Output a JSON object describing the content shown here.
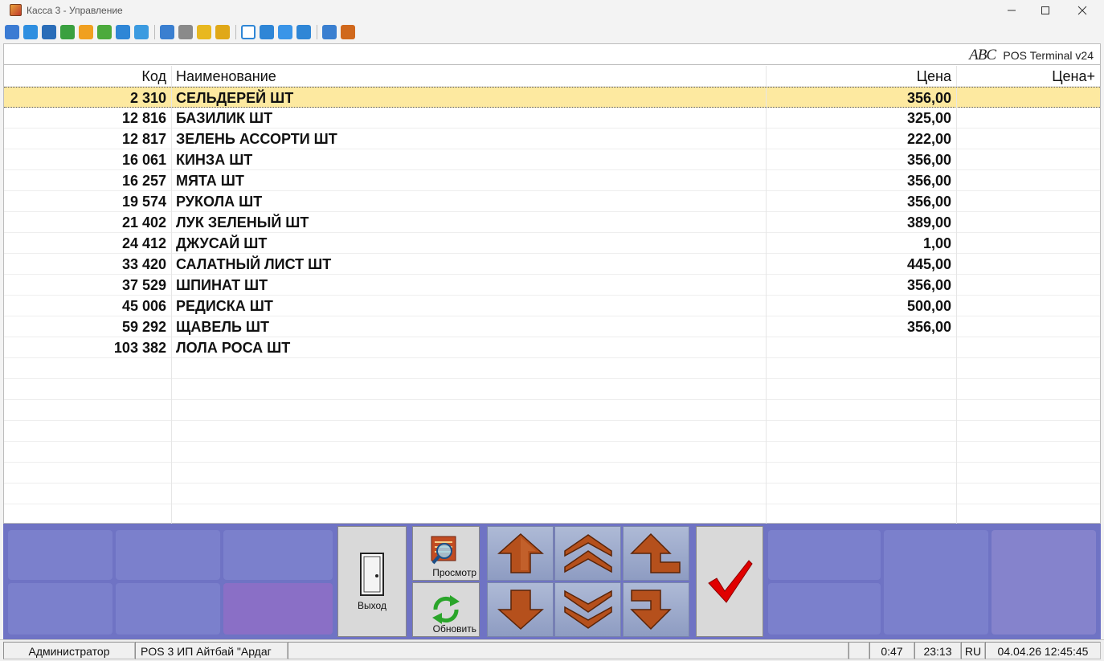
{
  "window": {
    "title": "Касса 3 - Управление"
  },
  "brand": {
    "logo": "ABC",
    "product": "POS Terminal v24"
  },
  "table": {
    "headers": {
      "code": "Код",
      "name": "Наименование",
      "price": "Цена",
      "price_plus": "Цена+"
    },
    "rows": [
      {
        "code": "2 310",
        "name": "СЕЛЬДЕРЕЙ ШТ",
        "price": "356,00",
        "price_plus": ""
      },
      {
        "code": "12 816",
        "name": "БАЗИЛИК ШТ",
        "price": "325,00",
        "price_plus": ""
      },
      {
        "code": "12 817",
        "name": "ЗЕЛЕНЬ АССОРТИ ШТ",
        "price": "222,00",
        "price_plus": ""
      },
      {
        "code": "16 061",
        "name": "КИНЗА ШТ",
        "price": "356,00",
        "price_plus": ""
      },
      {
        "code": "16 257",
        "name": "МЯТА ШТ",
        "price": "356,00",
        "price_plus": ""
      },
      {
        "code": "19 574",
        "name": "РУКОЛА ШТ",
        "price": "356,00",
        "price_plus": ""
      },
      {
        "code": "21 402",
        "name": "ЛУК ЗЕЛЕНЫЙ ШТ",
        "price": "389,00",
        "price_plus": ""
      },
      {
        "code": "24 412",
        "name": "ДЖУСАЙ ШТ",
        "price": "1,00",
        "price_plus": ""
      },
      {
        "code": "33 420",
        "name": "САЛАТНЫЙ ЛИСТ ШТ",
        "price": "445,00",
        "price_plus": ""
      },
      {
        "code": "37 529",
        "name": "ШПИНАТ ШТ",
        "price": "356,00",
        "price_plus": ""
      },
      {
        "code": "45 006",
        "name": "РЕДИСКА ШТ",
        "price": "500,00",
        "price_plus": ""
      },
      {
        "code": "59 292",
        "name": "ЩАВЕЛЬ ШТ",
        "price": "356,00",
        "price_plus": ""
      },
      {
        "code": "103 382",
        "name": "ЛОЛА РОСА ШТ",
        "price": "",
        "price_plus": ""
      }
    ],
    "empty_rows": 8,
    "selected_row": 0
  },
  "controls": {
    "exit_label": "Выход",
    "view_label": "Просмотр",
    "refresh_label": "Обновить"
  },
  "status": {
    "user": "Администратор",
    "terminal": "POS 3 ИП Айтбай \"Ардаг",
    "timer": "0:47",
    "time": "23:13",
    "lang": "RU",
    "datetime": "04.04.26 12:45:45"
  },
  "colors": {
    "selected_row": "#fde9a0",
    "panel": "#6f73c4",
    "arrow": "#b5501c",
    "check": "#e00000"
  }
}
